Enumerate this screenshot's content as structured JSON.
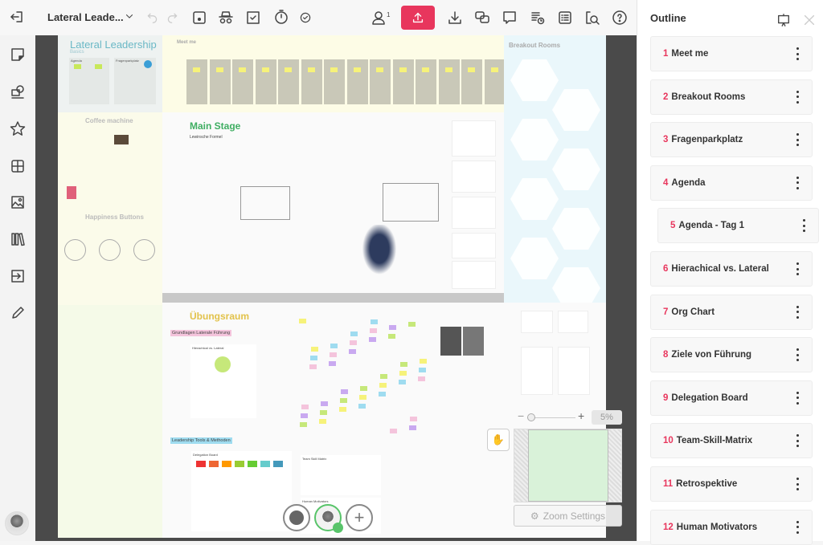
{
  "toolbar": {
    "board_title": "Lateral Leade...",
    "user_count": "1",
    "accent_color": "#e8365d",
    "icons": [
      "exit-icon",
      "chevron-down-icon",
      "undo-icon",
      "redo-icon",
      "frame-icon",
      "incognito-icon",
      "select-icon",
      "timer-icon",
      "check-circle-icon",
      "user-icon",
      "export-icon",
      "download-icon",
      "chat-icon",
      "comment-icon",
      "activity-icon",
      "list-icon",
      "search-icon",
      "help-icon"
    ]
  },
  "leftbar": {
    "tools": [
      "sticky-note-icon",
      "shapes-icon",
      "star-icon",
      "grid-icon",
      "image-icon",
      "library-icon",
      "import-icon",
      "pen-icon"
    ]
  },
  "board": {
    "sections": {
      "lateral_title": "Lateral Leadership",
      "lateral_subtitle": "Basics",
      "agenda": "Agenda",
      "fragenparkplatz": "Fragenparkplatz",
      "meet_me": "Meet me",
      "coffee_machine": "Coffee machine",
      "happiness_buttons": "Happiness Buttons",
      "main_stage": "Main Stage",
      "lewinsche_formel": "Lewinsche Formel",
      "breakout_rooms": "Breakout Rooms",
      "uebungsraum": "Übungsraum",
      "grundlagen": "Grundlagen Laterale Führung",
      "hierarchical_vs_lateral": "Hierachical vs. Lateral",
      "leadership_tools": "Leadership Tools & Methoden",
      "delegation_board": "Delegation Board",
      "team_skill_matrix": "Team Skill Matrix",
      "human_motivators": "Human Motivators"
    }
  },
  "zoom": {
    "level": "5%",
    "settings_label": "Zoom Settings",
    "minus": "−",
    "plus": "+"
  },
  "bottom": {
    "reaction_icon": "smiley-icon",
    "add_icon": "plus-icon"
  },
  "outline": {
    "title": "Outline",
    "items": [
      {
        "num": "1",
        "label": "Meet me"
      },
      {
        "num": "2",
        "label": "Breakout Rooms"
      },
      {
        "num": "3",
        "label": "Fragenparkplatz"
      },
      {
        "num": "4",
        "label": "Agenda"
      },
      {
        "num": "5",
        "label": "Agenda - Tag 1"
      },
      {
        "num": "6",
        "label": "Hierachical vs. Lateral"
      },
      {
        "num": "7",
        "label": "Org Chart"
      },
      {
        "num": "8",
        "label": "Ziele von Führung"
      },
      {
        "num": "9",
        "label": "Delegation Board"
      },
      {
        "num": "10",
        "label": "Team-Skill-Matrix"
      },
      {
        "num": "11",
        "label": "Retrospektive"
      },
      {
        "num": "12",
        "label": "Human Motivators"
      }
    ]
  }
}
